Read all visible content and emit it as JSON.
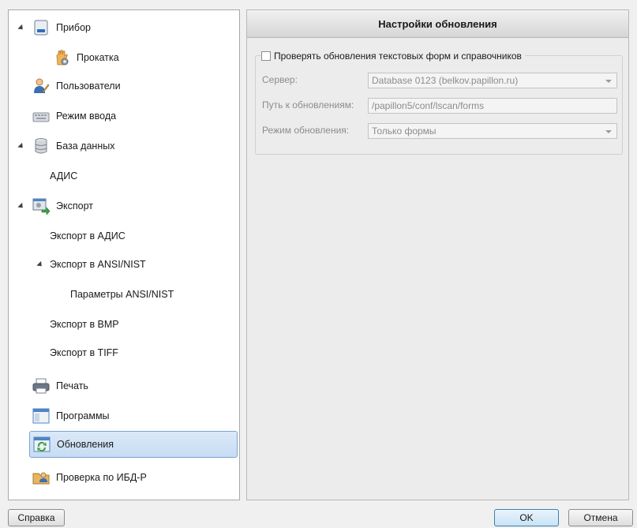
{
  "tree": {
    "items": [
      {
        "label": "Прибор",
        "icon": "device-icon"
      },
      {
        "label": "Прокатка",
        "icon": "hand-gear-icon"
      },
      {
        "label": "Пользователи",
        "icon": "user-edit-icon"
      },
      {
        "label": "Режим ввода",
        "icon": "keyboard-icon"
      },
      {
        "label": "База данных",
        "icon": "database-icon"
      },
      {
        "label": "АДИС"
      },
      {
        "label": "Экспорт",
        "icon": "export-icon"
      },
      {
        "label": "Экспорт в АДИС"
      },
      {
        "label": "Экспорт в ANSI/NIST"
      },
      {
        "label": "Параметры ANSI/NIST"
      },
      {
        "label": "Экспорт в BMP"
      },
      {
        "label": "Экспорт в TIFF"
      },
      {
        "label": "Печать",
        "icon": "printer-icon"
      },
      {
        "label": "Программы",
        "icon": "window-icon"
      },
      {
        "label": "Обновления",
        "icon": "update-icon",
        "selected": true
      },
      {
        "label": "Проверка по ИБД-Р",
        "icon": "folder-user-icon"
      }
    ]
  },
  "panel": {
    "title": "Настройки обновления",
    "check_updates_label": "Проверять обновления текстовых форм и справочников",
    "check_updates_checked": false,
    "server_label": "Сервер:",
    "server_value": "Database 0123 (belkov.papillon.ru)",
    "path_label": "Путь к обновлениям:",
    "path_value": "/papillon5/conf/lscan/forms",
    "mode_label": "Режим обновления:",
    "mode_value": "Только формы"
  },
  "buttons": {
    "help": "Справка",
    "ok": "OK",
    "cancel": "Отмена"
  },
  "colors": {
    "selection": "#c7dcf3",
    "selection_border": "#7aa4d6",
    "accent": "#3c7fb1"
  }
}
